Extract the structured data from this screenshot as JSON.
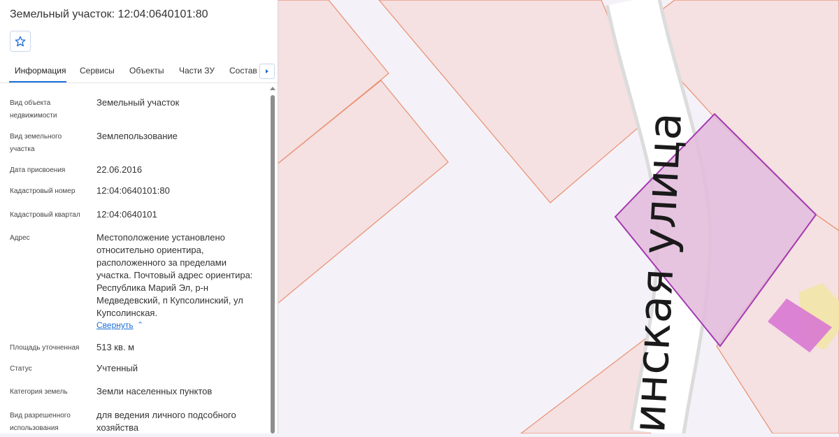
{
  "panel": {
    "title": "Земельный участок: 12:04:0640101:80",
    "tabs": [
      "Информация",
      "Сервисы",
      "Объекты",
      "Части ЗУ",
      "Состав"
    ],
    "collapse_label": "Свернуть",
    "fields": [
      {
        "label": "Вид объекта недвижимости",
        "value": "Земельный участок"
      },
      {
        "label": "Вид земельного участка",
        "value": "Землепользование"
      },
      {
        "label": "Дата присвоения",
        "value": "22.06.2016"
      },
      {
        "label": "Кадастровый номер",
        "value": "12:04:0640101:80"
      },
      {
        "label": "Кадастровый квартал",
        "value": "12:04:0640101"
      },
      {
        "label": "Адрес",
        "value": "Местоположение установлено относительно ориентира, расположенного за пределами участка. Почтовый адрес ориентира: Республика Марий Эл, р-н Медведевский, п Купсолинский, ул Купсолинская."
      },
      {
        "label": "Площадь уточненная",
        "value": "513 кв. м"
      },
      {
        "label": "Статус",
        "value": "Учтенный"
      },
      {
        "label": "Категория земель",
        "value": "Земли населенных пунктов"
      },
      {
        "label": "Вид разрешенного использования",
        "value": "для ведения личного подсобного хозяйства"
      }
    ]
  },
  "map": {
    "street_label": "инская улица",
    "colors": {
      "parcel_fill": "#f5e0e2",
      "parcel_stroke": "#e9906f",
      "selected_fill": "#e2bcdc",
      "selected_stroke": "#a43ab0",
      "small_fill": "#d978d4",
      "road": "#ffffff",
      "background": "#f4f2f8"
    }
  }
}
